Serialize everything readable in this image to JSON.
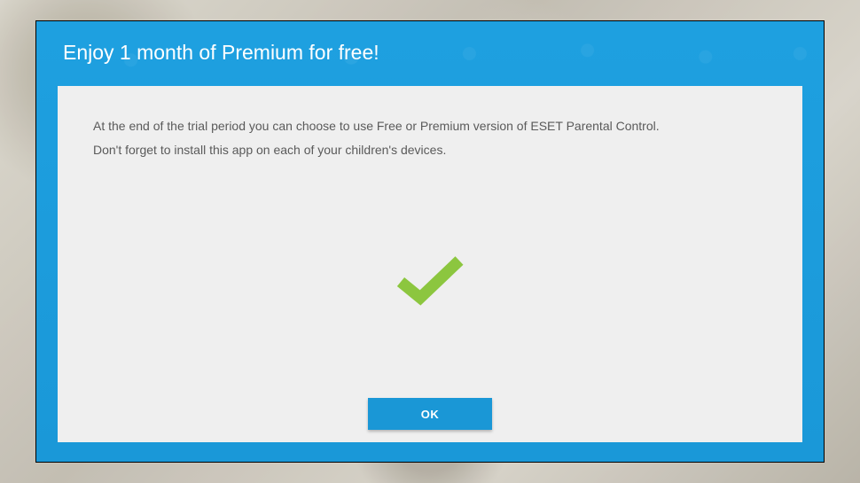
{
  "dialog": {
    "title": "Enjoy 1 month of Premium for free!",
    "body_line1": "At the end of the trial period you can choose to use Free or Premium version of ESET Parental Control.",
    "body_line2": "Don't forget to install this app on each of your children's devices.",
    "ok_label": "OK"
  },
  "colors": {
    "accent": "#1a97d6",
    "success": "#8cc63f"
  }
}
